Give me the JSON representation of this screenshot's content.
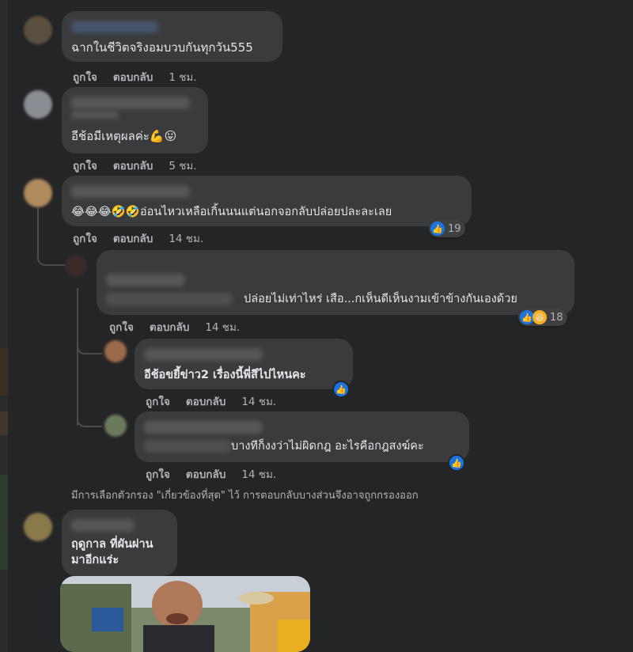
{
  "colors": {
    "background": "#242526",
    "bubble": "#3a3b3c",
    "text": "#e4e6eb",
    "muted": "#b0b3b8",
    "like": "#1b74e4"
  },
  "actions": {
    "like": "ถูกใจ",
    "reply": "ตอบกลับ"
  },
  "comments": [
    {
      "id": "c1",
      "text": "ฉากในชีวิตจริงอมบวบกันทุกวัน555",
      "time": "1 ชม."
    },
    {
      "id": "c2",
      "text": "อีช้อมีเหตุผลค่ะ💪😛",
      "time": "5 ชม."
    },
    {
      "id": "c3",
      "text": "😂😂😂🤣🤣อ่อนไหวเหลือเกิ้นนนแต่นอกจอกลับปล่อยปละละเลย",
      "time": "14 ชม.",
      "reactions": {
        "icons": [
          "like-icon"
        ],
        "count": "19"
      }
    },
    {
      "id": "r1",
      "text": "ปล่อยไม่เท่าไหร่ เสือ...กเห็นดีเห็นงามเข้าข้างกันเองด้วย",
      "time": "14 ชม.",
      "reactions": {
        "icons": [
          "like-icon",
          "haha-icon"
        ],
        "count": "18"
      }
    },
    {
      "id": "r2",
      "text": "อีช้อขยี้ข่าว2 เรื่องนี้พี่สีไปไหนคะ",
      "time": "14 ชม.",
      "reactions": {
        "icons": [
          "like-icon"
        ]
      }
    },
    {
      "id": "r3",
      "text": "บางทีก็งงว่าไม่ผิดกฎ อะไรคือกฎสงฆ์คะ",
      "time": "14 ชม.",
      "reactions": {
        "icons": [
          "like-icon"
        ]
      }
    },
    {
      "id": "c4",
      "text_line1": "ฤดูกาล ที่ผันผ่าน",
      "text_line2": "มาอีกแร่ะ"
    }
  ],
  "filter_note": "มีการเลือกตัวกรอง \"เกี่ยวข้องที่สุด\" ไว้ การตอบกลับบางส่วนจึงอาจถูกกรองออก"
}
